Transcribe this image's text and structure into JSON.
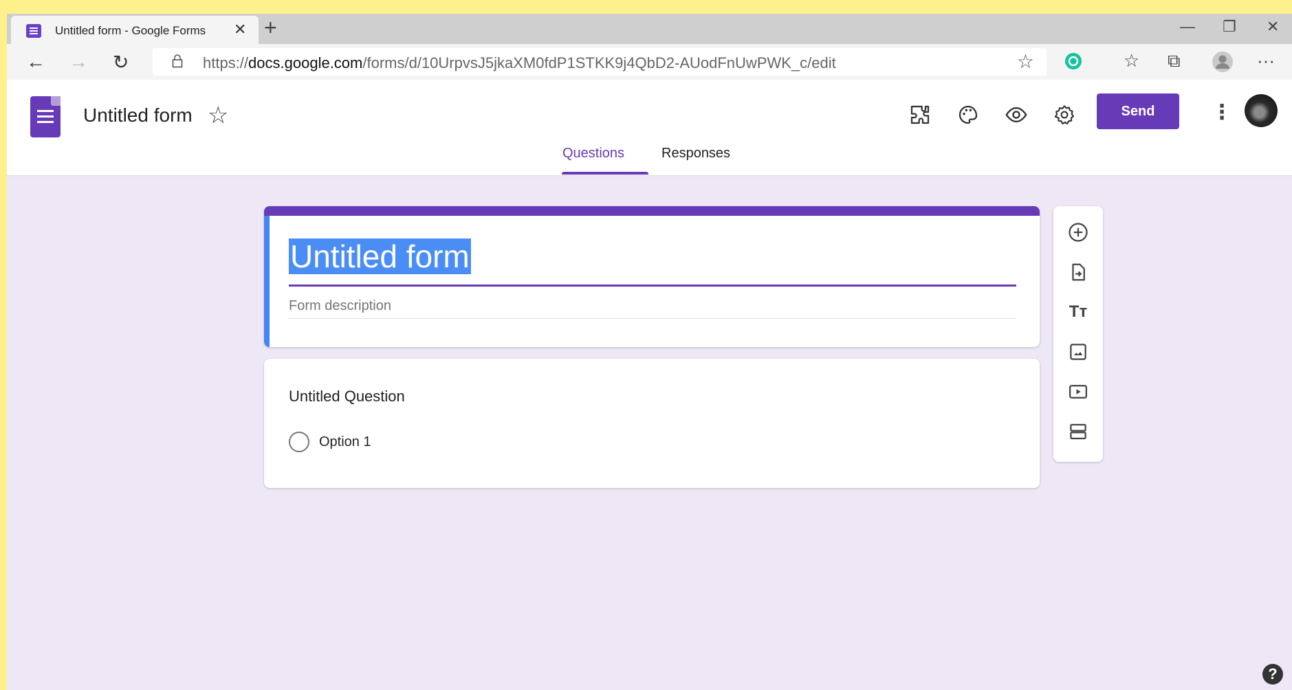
{
  "browser": {
    "tab_title": "Untitled form - Google Forms",
    "tab_close": "✕",
    "new_tab": "+",
    "url_prefix": "https://",
    "url_domain": "docs.google.com",
    "url_path": "/forms/d/10UrpvsJ5jkaXM0fdP1STKK9j4QbD2-AUodFnUwPWK_c/edit",
    "window_controls": {
      "minimize": "—",
      "restore": "❐",
      "close": "✕"
    }
  },
  "header": {
    "form_name": "Untitled form",
    "send_label": "Send",
    "icons": [
      "addons-icon",
      "palette-icon",
      "preview-icon",
      "settings-icon"
    ]
  },
  "tabs": {
    "questions": "Questions",
    "responses": "Responses",
    "active": "Questions"
  },
  "title_card": {
    "title": "Untitled form",
    "description_placeholder": "Form description"
  },
  "question_card": {
    "question": "Untitled Question",
    "options": [
      "Option 1"
    ]
  },
  "sidebar": {
    "icons": [
      "add-question-icon",
      "import-questions-icon",
      "add-title-icon",
      "add-image-icon",
      "add-video-icon",
      "add-section-icon"
    ]
  },
  "help": "?",
  "colors": {
    "accent": "#673ab7",
    "background": "#ede7f6",
    "selection": "#4a8ef5",
    "outer_frame": "#fef08a"
  }
}
